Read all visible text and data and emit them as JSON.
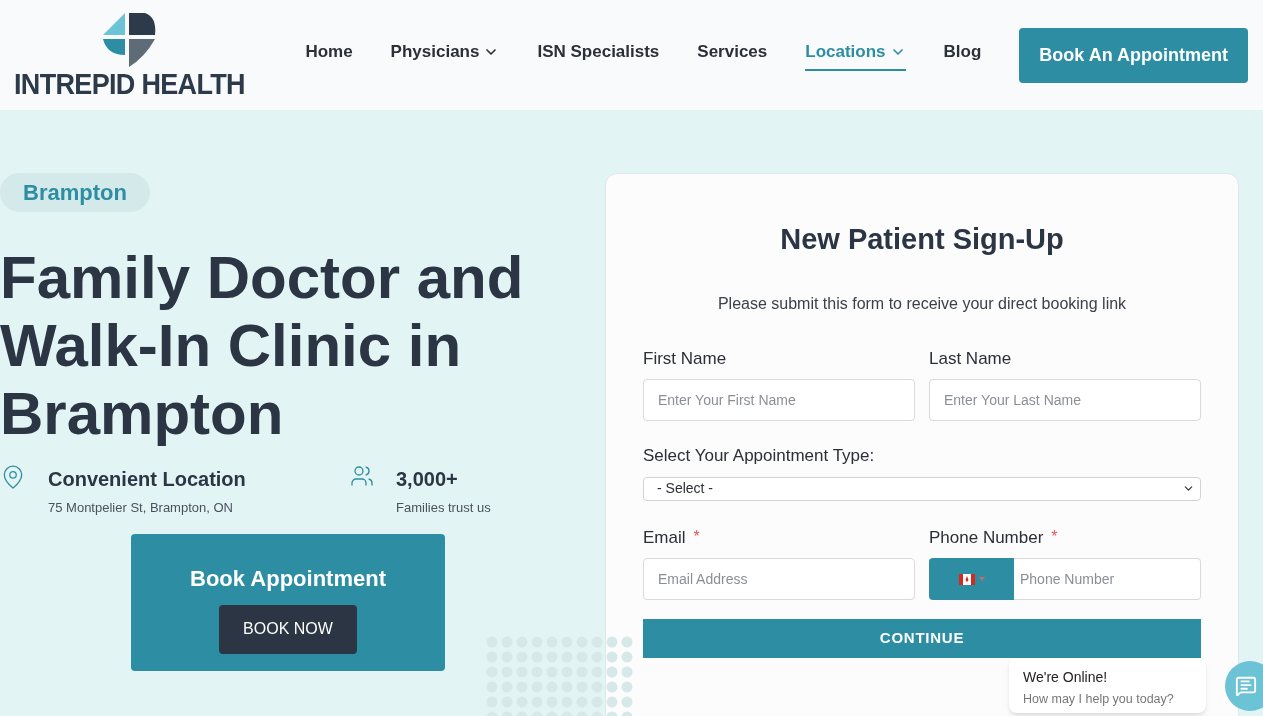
{
  "logo": {
    "text": "INTREPID HEALTH"
  },
  "nav": [
    {
      "label": "Home",
      "selected": false,
      "has_menu": false
    },
    {
      "label": "Physicians",
      "selected": false,
      "has_menu": true
    },
    {
      "label": "ISN Specialists",
      "selected": false,
      "has_menu": false
    },
    {
      "label": "Services",
      "selected": false,
      "has_menu": false
    },
    {
      "label": "Locations",
      "selected": true,
      "has_menu": true
    },
    {
      "label": "Blog",
      "selected": false,
      "has_menu": false
    }
  ],
  "header_button": "Book An Appointment",
  "hero": {
    "badge": "Brampton",
    "title": "Family Doctor and Walk-In Clinic in Brampton",
    "facts": [
      {
        "kind": "location",
        "heading": "Convenient Location",
        "text": "75 Montpelier St, Brampton, ON"
      },
      {
        "kind": "people",
        "heading": "3,000+",
        "text": "Families trust us"
      }
    ],
    "cta": {
      "title": "Book Appointment",
      "button": "BOOK NOW"
    }
  },
  "form": {
    "title": "New Patient Sign-Up",
    "subtitle": "Please submit this form to receive your direct booking link",
    "first_name": {
      "label": "First Name",
      "placeholder": "Enter Your First Name",
      "required": false
    },
    "last_name": {
      "label": "Last Name",
      "placeholder": "Enter Your Last Name",
      "required": false
    },
    "appointment_type": {
      "label": "Select Your Appointment Type:",
      "value": "- Select -"
    },
    "email": {
      "label": "Email",
      "placeholder": "Email Address",
      "required": true
    },
    "phone": {
      "label": "Phone Number",
      "placeholder": "Phone Number",
      "required": true
    },
    "submit": "CONTINUE",
    "required_mark": "*"
  },
  "chat": {
    "title": "We're Online!",
    "text": "How may I help you today?"
  }
}
